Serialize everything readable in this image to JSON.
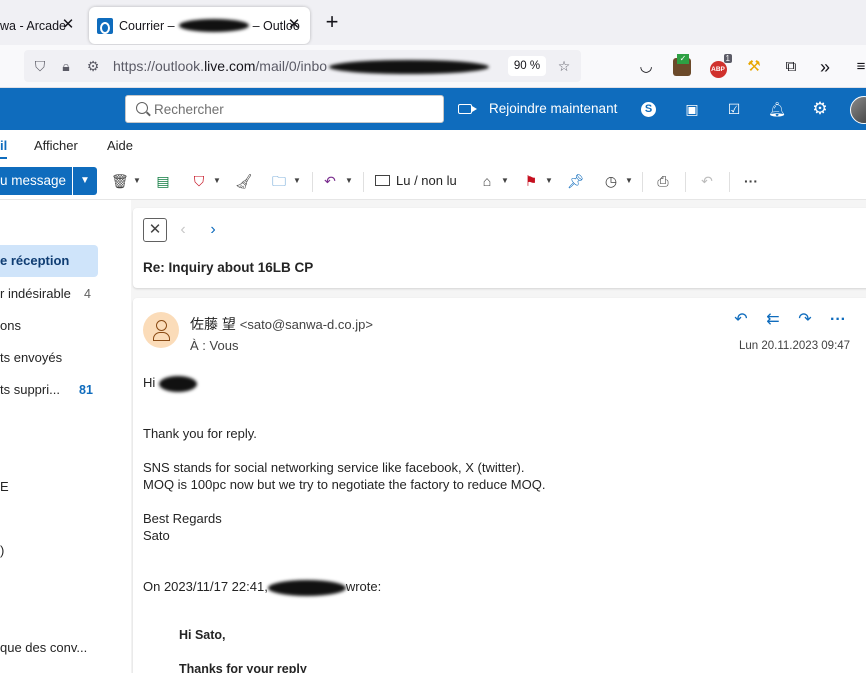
{
  "browser": {
    "tabs": [
      {
        "title": "wa - Arcade",
        "active": false
      },
      {
        "title": "Courrier –",
        "title_suffix": "– Outloo",
        "active": true
      }
    ],
    "url_prefix": "https://outlook.",
    "url_domain": "live.com",
    "url_path": "/mail/0/inbo",
    "zoom": "90 %",
    "ext_badge": "1",
    "ext_abp": "ABP"
  },
  "header": {
    "search_placeholder": "Rechercher",
    "join_label": "Rejoindre maintenant",
    "brand_color": "#0f6cbd"
  },
  "ribbon": {
    "tabs": [
      "il",
      "Afficher",
      "Aide"
    ]
  },
  "toolbar": {
    "new_message": "u message",
    "read_unread": "Lu / non lu",
    "more": "···"
  },
  "sidebar": {
    "folders": [
      {
        "label": "e réception",
        "count": "",
        "active": true
      },
      {
        "label": "r indésirable",
        "count": "4"
      },
      {
        "label": "ons",
        "count": ""
      },
      {
        "label": "ts envoyés",
        "count": ""
      },
      {
        "label": "ts suppri...",
        "count": "81"
      },
      {
        "label": "E",
        "count": ""
      },
      {
        "label": ")",
        "count": ""
      },
      {
        "label": "que des conv...",
        "count": ""
      }
    ]
  },
  "email": {
    "subject": "Re: Inquiry about 16LB CP",
    "sender_name": "佐藤 望",
    "sender_email": "<sato@sanwa-d.co.jp>",
    "to_label": "À :",
    "to_value": "Vous",
    "date": "Lun 20.11.2023 09:47",
    "greeting": "Hi",
    "body": [
      "Thank you for reply.",
      "SNS stands for social networking service like facebook, X (twitter).",
      "MOQ is 100pc now but we try to negotiate the factory to reduce MOQ.",
      "Best Regards",
      "Sato"
    ],
    "quote_header_prefix": "On 2023/11/17 22:41,",
    "quote_header_suffix": "wrote:",
    "quote_greeting": "Hi Sato,",
    "quote_line": "Thanks for your reply"
  }
}
